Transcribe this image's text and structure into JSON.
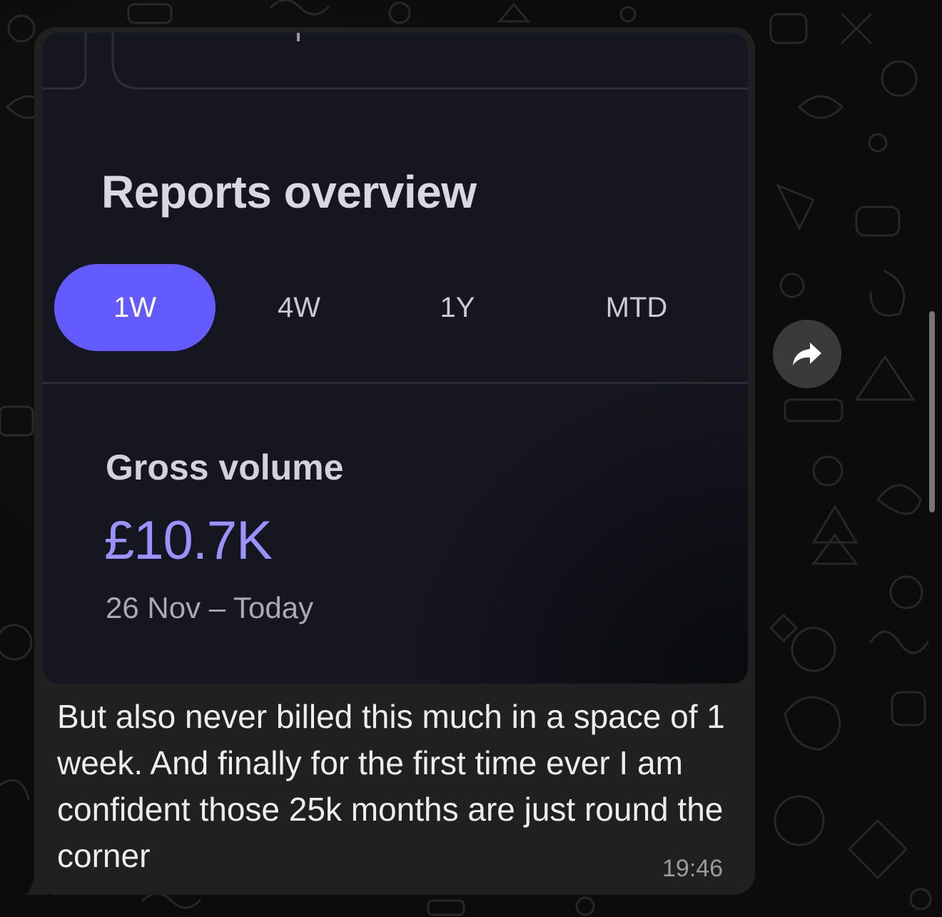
{
  "chat": {
    "message": {
      "image": {
        "reports_title": "Reports overview",
        "tabs": [
          {
            "label": "1W",
            "active": true
          },
          {
            "label": "4W",
            "active": false
          },
          {
            "label": "1Y",
            "active": false
          },
          {
            "label": "MTD",
            "active": false
          }
        ],
        "gross_volume": {
          "label": "Gross volume",
          "value": "£10.7K",
          "date_range": "26 Nov – Today"
        },
        "accent_color": "#635bff"
      },
      "text": "But also never billed this much in a space of 1 week. And finally for the first time ever I am confident those 25k months are just round the corner",
      "time": "19:46"
    },
    "forward_icon": "forward-arrow-icon"
  }
}
